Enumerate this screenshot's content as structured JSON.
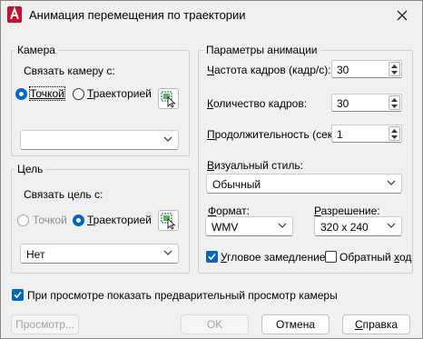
{
  "window": {
    "title": "Анимация перемещения по траектории",
    "close_icon": "close-icon",
    "app_icon": "autocad-app-icon"
  },
  "camera": {
    "legend": "Камера",
    "link_label": "Связать камеру с:",
    "option_point": "Точкой",
    "option_path": "Траекторией",
    "selected": "point",
    "pick_icon": "pick-object-icon",
    "dropdown_value": ""
  },
  "target": {
    "legend": "Цель",
    "link_label": "Связать цель с:",
    "option_point": "Точкой",
    "option_path": "Траекторией",
    "selected": "path",
    "point_disabled": true,
    "pick_icon": "pick-object-icon",
    "dropdown_value": "Нет"
  },
  "animation": {
    "legend": "Параметры анимации",
    "fps_label": "Частота кадров (кадр/с):",
    "fps_value": "30",
    "frames_label": "Количество кадров:",
    "frames_value": "30",
    "duration_label": "Продолжительность (сек.):",
    "duration_value": "1",
    "visual_style_label": "Визуальный стиль:",
    "visual_style_value": "Обычный",
    "format_label": "Формат:",
    "format_value": "WMV",
    "resolution_label": "Разрешение:",
    "resolution_value": "320 x 240",
    "corner_decel_label": "Угловое замедление",
    "corner_decel_checked": true,
    "reverse_label": "Обратный ход",
    "reverse_checked": false
  },
  "preview_option": {
    "label": "При просмотре показать предварительный просмотр камеры",
    "checked": true
  },
  "buttons": {
    "preview": "Просмотр...",
    "ok": "OK",
    "cancel": "Отмена",
    "help": "Справка"
  },
  "colors": {
    "accent": "#0067c0",
    "app_icon_red": "#c8102e",
    "dialog_bg": "#f0f0f0"
  }
}
